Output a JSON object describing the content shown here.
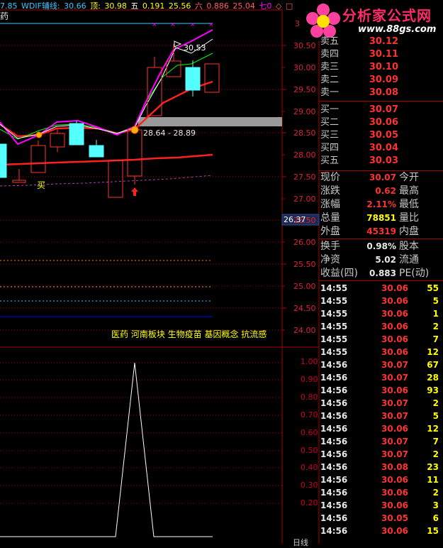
{
  "header": {
    "prefix": "7.85",
    "wdif_label": "WDIF辅线:",
    "wdif_value": "30.66",
    "top_label": "顶:",
    "top_value": "30.98",
    "five_label": "五",
    "five_value1": "0.191",
    "five_value2": "25.56",
    "six_label": "六",
    "six_value1": "0.886",
    "six_value2": "25.04",
    "seven_label": "七0",
    "stock_suffix": "药"
  },
  "chart": {
    "price_axis": [
      "30.50",
      "30.00",
      "29.50",
      "29.00",
      "28.50",
      "28.00",
      "27.50",
      "27.00",
      "26.50",
      "26.00",
      "25.50",
      "25.00",
      "24.50",
      "24.00"
    ],
    "top_tick": "3",
    "current_price_tag": "26.37",
    "peak_annotation": "30.53",
    "range_annotation": "28.64 - 28.89",
    "buy_marker": "买",
    "concepts": "医药 河南板块 生物疫苗 基因概念 抗流感",
    "indicator_axis": [
      "1.00",
      "0.90",
      "0.80",
      "0.70",
      "0.60",
      "0.50",
      "0.40",
      "0.30",
      "0.20"
    ],
    "bottom_label": "日线",
    "colors": {
      "up": "#ff3232",
      "down": "#54ffff",
      "grid": "#a00000",
      "ma_white": "#ffffff",
      "ma_magenta": "#ff00ff",
      "ma_green": "#00ff00",
      "ma_red": "#ff0000"
    }
  },
  "logo": {
    "title": "分析家公式网",
    "url": "www.88gs.com"
  },
  "orderbook": {
    "asks": [
      {
        "label": "卖五",
        "price": "30.12"
      },
      {
        "label": "卖四",
        "price": "30.11"
      },
      {
        "label": "卖三",
        "price": "30.10"
      },
      {
        "label": "卖二",
        "price": "30.09"
      },
      {
        "label": "卖一",
        "price": "30.08"
      }
    ],
    "bids": [
      {
        "label": "买一",
        "price": "30.07"
      },
      {
        "label": "买二",
        "price": "30.06"
      },
      {
        "label": "买三",
        "price": "30.05"
      },
      {
        "label": "买四",
        "price": "30.04"
      },
      {
        "label": "买五",
        "price": "30.03"
      }
    ]
  },
  "stats": [
    {
      "label": "现价",
      "value": "30.07",
      "color": "#ff3232",
      "label2": "今开"
    },
    {
      "label": "涨跌",
      "value": "0.62",
      "color": "#ff3232",
      "label2": "最高"
    },
    {
      "label": "涨幅",
      "value": "2.11%",
      "color": "#ff3232",
      "label2": "最低"
    },
    {
      "label": "总量",
      "value": "78851",
      "color": "#ffff00",
      "label2": "量比"
    },
    {
      "label": "外盘",
      "value": "45319",
      "color": "#ff3232",
      "label2": "内盘"
    },
    {
      "label": "换手",
      "value": "0.98%",
      "color": "#e8e8e8",
      "label2": "股本"
    },
    {
      "label": "净资",
      "value": "5.02",
      "color": "#e8e8e8",
      "label2": "流通"
    },
    {
      "label": "收益(四)",
      "value": "0.883",
      "color": "#e8e8e8",
      "label2": "PE(动)"
    }
  ],
  "ticks": [
    {
      "time": "14:55",
      "price": "30.06",
      "vol": "55",
      "color": "#ff3232"
    },
    {
      "time": "14:55",
      "price": "30.06",
      "vol": "5",
      "color": "#ff3232"
    },
    {
      "time": "14:55",
      "price": "30.06",
      "vol": "1",
      "color": "#ff3232"
    },
    {
      "time": "14:55",
      "price": "30.06",
      "vol": "2",
      "color": "#ff3232"
    },
    {
      "time": "14:55",
      "price": "30.06",
      "vol": "7",
      "color": "#ff3232"
    },
    {
      "time": "14:55",
      "price": "30.06",
      "vol": "12",
      "color": "#ff3232"
    },
    {
      "time": "14:56",
      "price": "30.07",
      "vol": "67",
      "color": "#ff3232"
    },
    {
      "time": "14:56",
      "price": "30.07",
      "vol": "28",
      "color": "#ff3232"
    },
    {
      "time": "14:56",
      "price": "30.06",
      "vol": "93",
      "color": "#ff3232"
    },
    {
      "time": "14:56",
      "price": "30.07",
      "vol": "2",
      "color": "#ff3232"
    },
    {
      "time": "14:56",
      "price": "30.07",
      "vol": "5",
      "color": "#ff3232"
    },
    {
      "time": "14:56",
      "price": "30.06",
      "vol": "12",
      "color": "#ff3232"
    },
    {
      "time": "14:56",
      "price": "30.07",
      "vol": "7",
      "color": "#ff3232"
    },
    {
      "time": "14:56",
      "price": "30.07",
      "vol": "2",
      "color": "#ff3232"
    },
    {
      "time": "14:56",
      "price": "30.08",
      "vol": "23",
      "color": "#ff3232"
    },
    {
      "time": "14:56",
      "price": "30.06",
      "vol": "11",
      "color": "#ff3232"
    },
    {
      "time": "14:56",
      "price": "30.06",
      "vol": "2",
      "color": "#ff3232"
    },
    {
      "time": "14:56",
      "price": "30.06",
      "vol": "3",
      "color": "#ff3232"
    },
    {
      "time": "14:56",
      "price": "30.05",
      "vol": "6",
      "color": "#ff3232"
    },
    {
      "time": "14:56",
      "price": "30.06",
      "vol": "15",
      "color": "#ff3232"
    }
  ]
}
